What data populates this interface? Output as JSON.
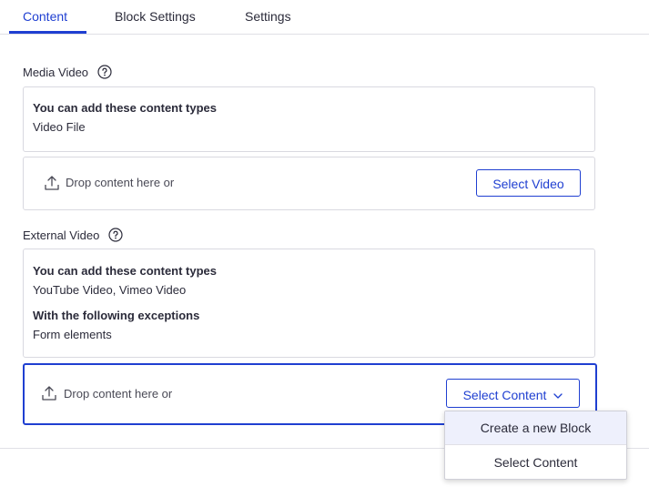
{
  "tabs": [
    {
      "label": "Content",
      "active": true
    },
    {
      "label": "Block Settings",
      "active": false
    },
    {
      "label": "Settings",
      "active": false
    }
  ],
  "media_video": {
    "label": "Media Video",
    "allowed_heading": "You can add these content types",
    "allowed_types": "Video File",
    "drop_text": "Drop content here or",
    "select_button": "Select Video"
  },
  "external_video": {
    "label": "External Video",
    "allowed_heading": "You can add these content types",
    "allowed_types": "YouTube Video, Vimeo Video",
    "exceptions_heading": "With the following exceptions",
    "exceptions": "Form elements",
    "drop_text": "Drop content here or",
    "select_button": "Select Content"
  },
  "dropdown_menu": {
    "items": [
      {
        "label": "Create a new Block",
        "highlighted": true
      },
      {
        "label": "Select Content",
        "highlighted": false
      }
    ]
  },
  "colors": {
    "accent": "#1f3fd1",
    "border": "#d9d9e0",
    "text": "#2b2b3a",
    "hover": "#eef0fc"
  },
  "icons": {
    "help": "question-circle-icon",
    "upload": "upload-icon",
    "chevron": "chevron-down-icon"
  }
}
